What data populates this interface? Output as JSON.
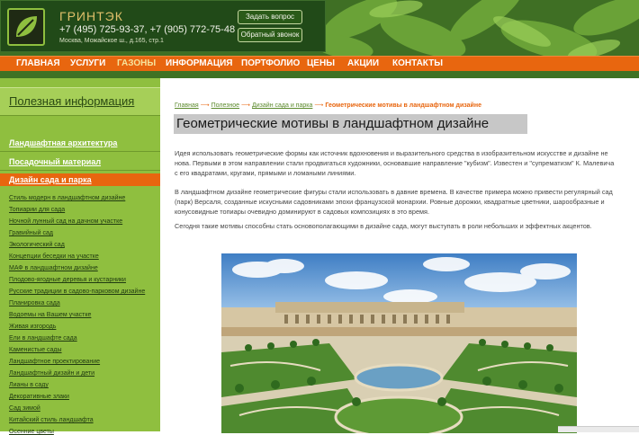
{
  "header": {
    "brand": "ГРИНТЭК",
    "phones": "+7 (495) 725-93-37, +7 (905) 772-75-48",
    "address": "Москва, Можайское ш., д.165, стр.1",
    "ask_button": "Задать вопрос",
    "callback_button": "Обратный звонок"
  },
  "nav": {
    "items": [
      "ГЛАВНАЯ",
      "УСЛУГИ",
      "ГАЗОНЫ",
      "ИНФОРМАЦИЯ",
      "ПОРТФОЛИО",
      "ЦЕНЫ",
      "АКЦИИ",
      "КОНТАКТЫ"
    ],
    "active": "ГАЗОНЫ"
  },
  "sidebar": {
    "title": "Полезная информация",
    "main_items": [
      "Ландшафтная архитектура",
      "Посадочный материал",
      "Дизайн сада и парка"
    ],
    "sub_items": [
      "Стиль модерн в ландшафтном дизайне",
      "Топиарии для сада",
      "Ночной лунный сад на дачном участке",
      "Гравийный сад",
      "Экологический сад",
      "Концепции беседки на участке",
      "МАФ в ландшафтном дизайне",
      "Плодово-ягодные деревья и кустарники",
      "Русские традиции в садово-парковом дизайне",
      "Планировка сада",
      "Водоемы на Вашем участке",
      "Живая изгородь",
      "Ели в ландшафте сада",
      "Каменистые сады",
      "Ландшафтное проектирование",
      "Ландшафтный дизайн и дети",
      "Лианы в саду",
      "Декоративные злаки",
      "Сад зимой",
      "Китайский стиль ландшафта",
      "Осенние цветы"
    ]
  },
  "breadcrumb": {
    "items": [
      "Главная",
      "Полезное",
      "Дизайн сада и парка"
    ],
    "current": "Геометрические мотивы в ландшафтном дизайне",
    "sep": "⟶"
  },
  "content": {
    "title": "Геометрические мотивы в ландшафтном дизайне",
    "p1": "Идея использовать геометрические формы как источник вдохновения и выразительного средства в изобразительном искусстве и дизайне не нова. Первыми в этом направлении стали продвигаться художники, основавшие направление \"кубизм\". Известен и \"супрематизм\" К. Малевича с его квадратами, кругами, прямыми и ломаными линиями.",
    "p2": "В ландшафтном дизайне геометрические фигуры стали использовать в давние времена. В качестве примера можно привести регулярный сад (парк) Версаля, созданные искусными садовниками эпохи французской монархии. Ровные дорожки, квадратные цветники, шарообразные и конусовидные топиары очевидно доминируют в садовых композициях в это время.",
    "p3": "Сегодня такие мотивы способны стать основополагающими в дизайне сада, могут выступать в роли небольших и эффектных акцентов."
  },
  "colors": {
    "nav_orange": "#e8660f",
    "sidebar_green": "#8fbf3f",
    "header_green": "#214a18"
  }
}
